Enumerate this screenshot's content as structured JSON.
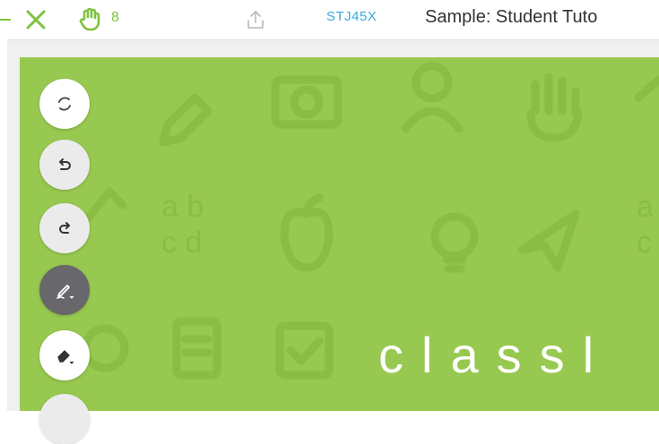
{
  "header": {
    "hand_count": "8",
    "class_code": "STJ45X",
    "class_name": "Sample: Student Tuto",
    "icons": {
      "close": "close-icon",
      "hand": "raised-hand-icon",
      "upload": "upload-icon"
    }
  },
  "board": {
    "wordmark": "classl",
    "pattern_letters": [
      "a b",
      "c d",
      "a",
      "c"
    ],
    "background_color": "#97c84f"
  },
  "tools": [
    {
      "name": "refresh",
      "icon": "refresh-icon"
    },
    {
      "name": "undo",
      "icon": "undo-icon"
    },
    {
      "name": "redo",
      "icon": "redo-icon"
    },
    {
      "name": "pen",
      "icon": "pen-icon",
      "selected": true
    },
    {
      "name": "eraser",
      "icon": "eraser-icon"
    }
  ],
  "colors": {
    "accent_green": "#7fc241",
    "code_blue": "#39a8e0",
    "selected_tool": "#68676b"
  }
}
